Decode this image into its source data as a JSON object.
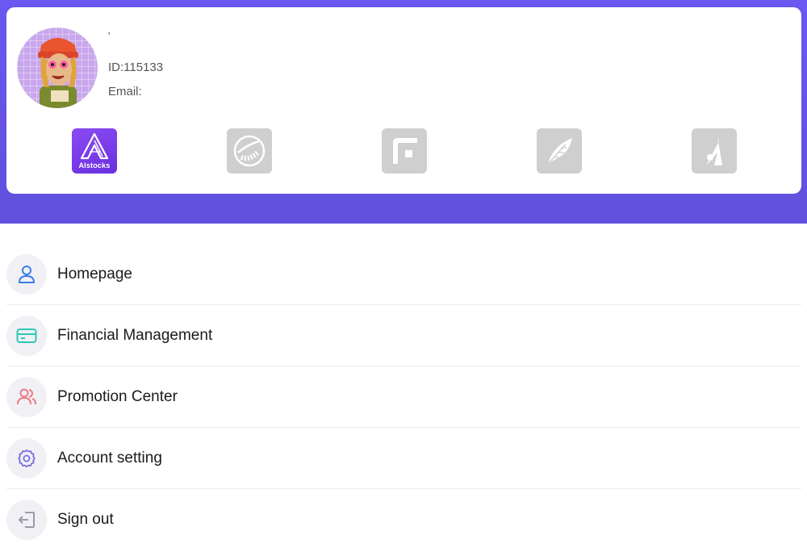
{
  "profile": {
    "nickname": "'",
    "id_label": "ID:",
    "id_value": "115133",
    "email_label": "Email:",
    "email_value": ""
  },
  "apps": [
    {
      "name": "aistocks-app",
      "label": "AIstocks",
      "active": true
    },
    {
      "name": "rocket-app",
      "label": "",
      "active": false
    },
    {
      "name": "square-app",
      "label": "",
      "active": false
    },
    {
      "name": "feather-app",
      "label": "",
      "active": false
    },
    {
      "name": "climber-app",
      "label": "",
      "active": false
    }
  ],
  "menu": [
    {
      "label": "Homepage",
      "icon": "user-icon",
      "color": "#3b7ce8"
    },
    {
      "label": "Financial Management",
      "icon": "card-icon",
      "color": "#2ec9b5"
    },
    {
      "label": "Promotion Center",
      "icon": "users-icon",
      "color": "#ee7b86"
    },
    {
      "label": "Account setting",
      "icon": "gear-icon",
      "color": "#7b6de0"
    },
    {
      "label": "Sign out",
      "icon": "logout-icon",
      "color": "#9a9aa8"
    }
  ],
  "colors": {
    "header_gradient_top": "#6b58f0",
    "header_gradient_bottom": "#5f51dd",
    "active_app": "#7a3ce8",
    "inactive_app": "#cfcfcf"
  }
}
